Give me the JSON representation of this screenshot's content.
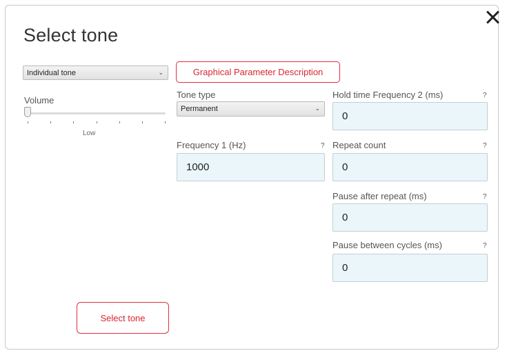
{
  "dialog": {
    "title": "Select tone",
    "close_icon": "close-icon"
  },
  "tone_select": {
    "selected": "Individual tone"
  },
  "graphical_button": {
    "label": "Graphical Parameter Description"
  },
  "volume": {
    "label": "Volume",
    "level_label": "Low",
    "level": 0
  },
  "tone_type": {
    "label": "Tone type",
    "selected": "Permanent"
  },
  "frequency1": {
    "label": "Frequency 1 (Hz)",
    "value": "1000",
    "help": "?"
  },
  "hold_time_f2": {
    "label": "Hold time Frequency 2 (ms)",
    "value": "0",
    "help": "?"
  },
  "repeat_count": {
    "label": "Repeat count",
    "value": "0",
    "help": "?"
  },
  "pause_after_repeat": {
    "label": "Pause after repeat (ms)",
    "value": "0",
    "help": "?"
  },
  "pause_between_cycles": {
    "label": "Pause between cycles (ms)",
    "value": "0",
    "help": "?"
  },
  "select_button": {
    "label": "Select tone"
  },
  "colors": {
    "accent": "#d8262f",
    "input_bg": "#eaf6f9"
  }
}
